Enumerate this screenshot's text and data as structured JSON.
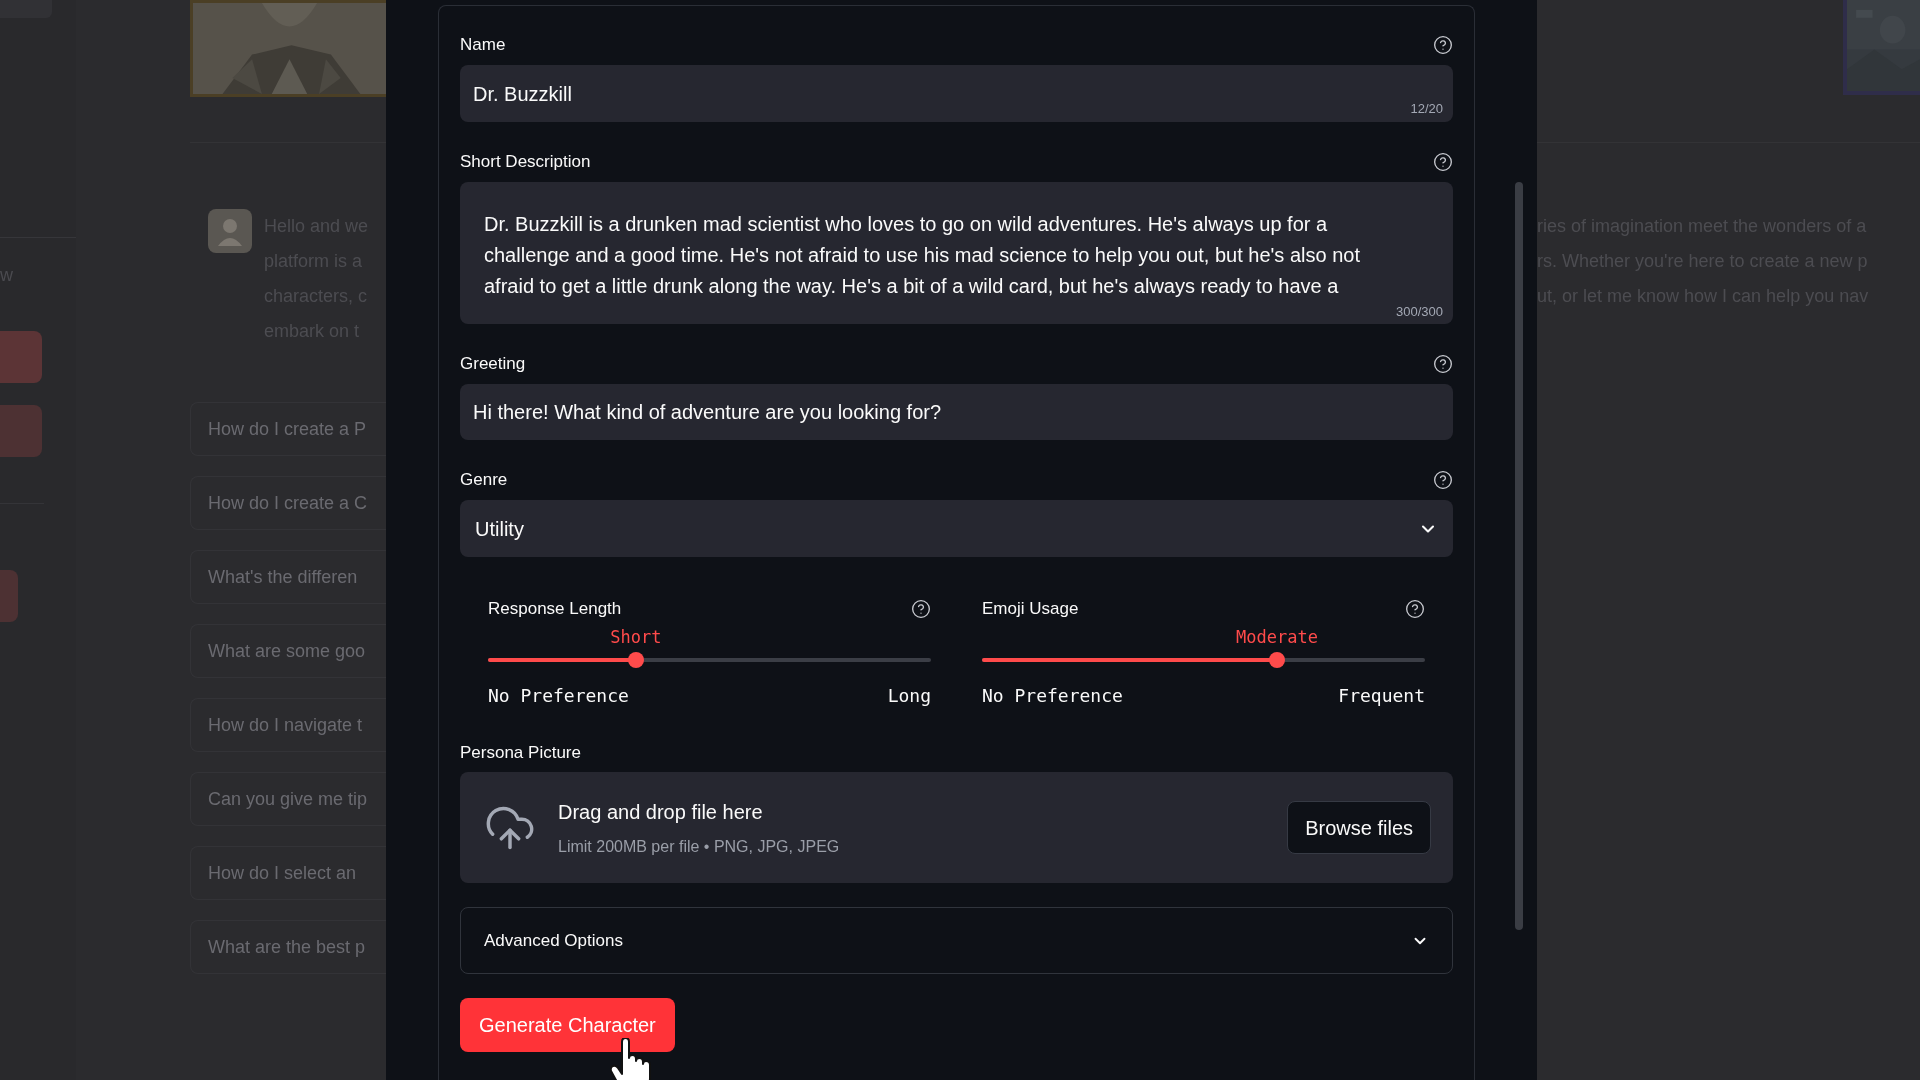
{
  "sidebar": {
    "text": "w"
  },
  "chat": {
    "message_left": [
      "Hello and we",
      "platform is a",
      "characters, c",
      "embark on t"
    ],
    "message_right": [
      "ries of imagination meet the wonders of a",
      "rs. Whether you're here to create a new p",
      "ut, or let me know how I can help you nav"
    ],
    "suggestions": [
      "How do I create a P",
      "How do I create a C",
      "What's the differen",
      "What are some goo",
      "How do I navigate t",
      "Can you give me tip",
      "How do I select an",
      "What are the best p"
    ]
  },
  "form": {
    "name": {
      "label": "Name",
      "value": "Dr. Buzzkill",
      "counter": "12/20"
    },
    "description": {
      "label": "Short Description",
      "value": "Dr. Buzzkill is a drunken mad scientist who loves to go on wild adventures. He's always up for a\nchallenge and a good time. He's not afraid to use his mad science to help you out, but he's also not\nafraid to get a little drunk along the way. He's a bit of a wild card, but he's always ready to have a",
      "counter": "300/300"
    },
    "greeting": {
      "label": "Greeting",
      "value": "Hi there! What kind of adventure are you looking for?"
    },
    "genre": {
      "label": "Genre",
      "value": "Utility"
    },
    "sliders": [
      {
        "label": "Response Length",
        "value": "Short",
        "level": 0.334,
        "min": "No Preference",
        "max": "Long"
      },
      {
        "label": "Emoji Usage",
        "value": "Moderate",
        "level": 0.666,
        "min": "No Preference",
        "max": "Frequent"
      }
    ],
    "upload": {
      "label": "Persona Picture",
      "title": "Drag and drop file here",
      "hint": "Limit 200MB per file • PNG, JPG, JPEG",
      "button": "Browse files"
    },
    "advanced": {
      "label": "Advanced Options",
      "expanded": false
    },
    "submit": "Generate Character"
  }
}
